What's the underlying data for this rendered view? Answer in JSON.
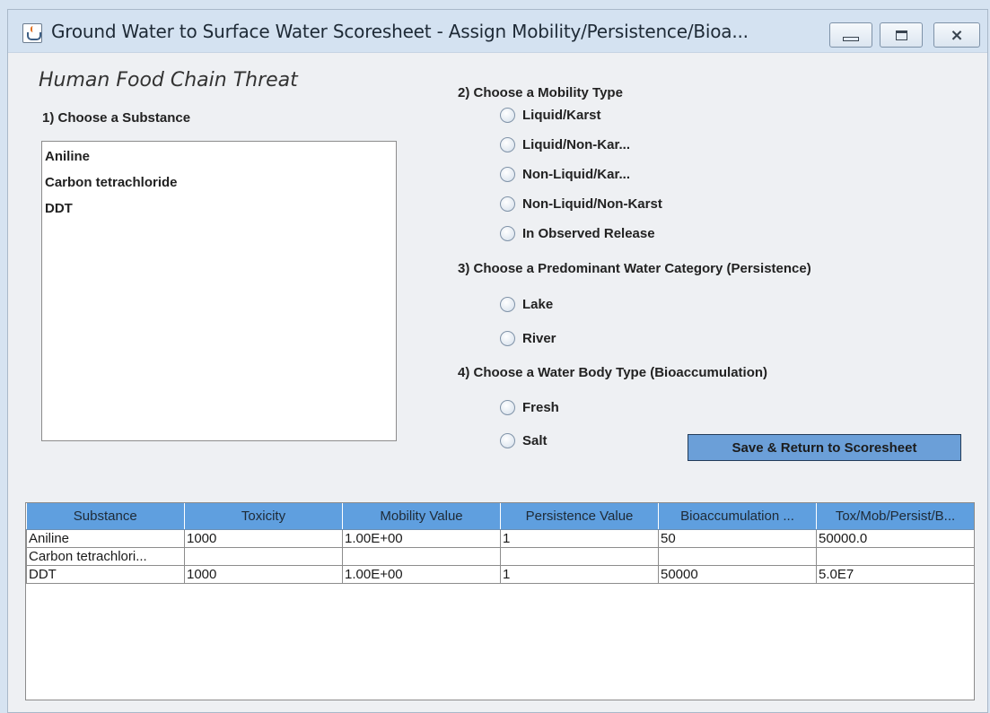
{
  "window": {
    "title": "Ground Water to Surface Water Scoresheet - Assign Mobility/Persistence/Bioa...",
    "controls": {
      "minimize_icon": "minimize-icon",
      "maximize_icon": "maximize-icon",
      "close_icon": "close-icon",
      "close_glyph": "⨯"
    }
  },
  "section_title": "Human Food Chain Threat",
  "substance_section": {
    "label": "1) Choose a Substance",
    "items": [
      "Aniline",
      "Carbon tetrachloride",
      "DDT"
    ]
  },
  "mobility_section": {
    "label": "2) Choose a Mobility Type",
    "options": [
      "Liquid/Karst",
      "Liquid/Non-Kar...",
      "Non-Liquid/Kar...",
      "Non-Liquid/Non-Karst",
      "In Observed Release"
    ]
  },
  "persistence_section": {
    "label": "3) Choose a Predominant Water Category (Persistence)",
    "options": [
      "Lake",
      "River"
    ]
  },
  "bioaccumulation_section": {
    "label": "4) Choose a Water Body Type (Bioaccumulation)",
    "options": [
      "Fresh",
      "Salt"
    ]
  },
  "save_button_label": "Save & Return to Scoresheet",
  "table": {
    "headers": [
      "Substance",
      "Toxicity",
      "Mobility Value",
      "Persistence Value",
      "Bioaccumulation ...",
      "Tox/Mob/Persist/B..."
    ],
    "rows": [
      [
        "Aniline",
        "1000",
        "1.00E+00",
        "1",
        "50",
        "50000.0"
      ],
      [
        "Carbon tetrachlori...",
        "",
        "",
        "",
        "",
        ""
      ],
      [
        "DDT",
        "1000",
        "1.00E+00",
        "1",
        "50000",
        "5.0E7"
      ]
    ]
  },
  "colors": {
    "title_bar": "#d4e2f1",
    "table_header": "#5f9fdf",
    "save_button": "#6b9fd8"
  }
}
